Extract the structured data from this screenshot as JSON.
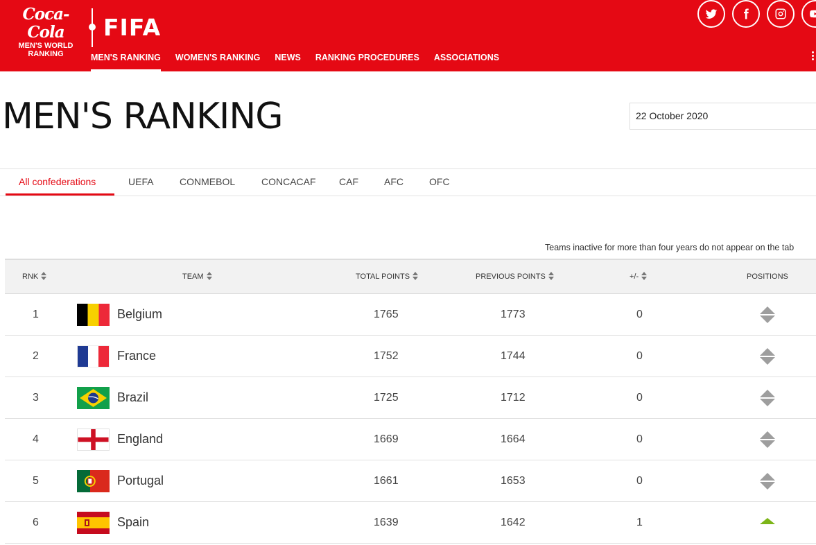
{
  "header": {
    "brand": {
      "logo_text": "Coca-Cola",
      "line1": "MEN'S WORLD",
      "line2": "RANKING",
      "fifa": "FIFA"
    },
    "nav": [
      {
        "label": "MEN'S RANKING",
        "active": true
      },
      {
        "label": "WOMEN'S RANKING",
        "active": false
      },
      {
        "label": "NEWS",
        "active": false
      },
      {
        "label": "RANKING PROCEDURES",
        "active": false
      },
      {
        "label": "ASSOCIATIONS",
        "active": false
      }
    ],
    "social": [
      "twitter-icon",
      "facebook-icon",
      "instagram-icon",
      "youtube-icon"
    ],
    "brand_color": "#e50914"
  },
  "page": {
    "title": "MEN'S RANKING",
    "date": "22 October 2020"
  },
  "tabs": [
    {
      "label": "All confederations",
      "active": true
    },
    {
      "label": "UEFA",
      "active": false
    },
    {
      "label": "CONMEBOL",
      "active": false
    },
    {
      "label": "CONCACAF",
      "active": false
    },
    {
      "label": "CAF",
      "active": false
    },
    {
      "label": "AFC",
      "active": false
    },
    {
      "label": "OFC",
      "active": false
    }
  ],
  "note": "Teams inactive for more than four years do not appear on the tab",
  "table": {
    "columns": {
      "rank": "RNK",
      "team": "TEAM",
      "total_points": "TOTAL POINTS",
      "previous_points": "PREVIOUS POINTS",
      "change": "+/-",
      "positions": "POSITIONS"
    },
    "rows": [
      {
        "rank": "1",
        "team": "Belgium",
        "flag": "belgium",
        "total": "1765",
        "previous": "1773",
        "change": "0",
        "movement": "same"
      },
      {
        "rank": "2",
        "team": "France",
        "flag": "france",
        "total": "1752",
        "previous": "1744",
        "change": "0",
        "movement": "same"
      },
      {
        "rank": "3",
        "team": "Brazil",
        "flag": "brazil",
        "total": "1725",
        "previous": "1712",
        "change": "0",
        "movement": "same"
      },
      {
        "rank": "4",
        "team": "England",
        "flag": "england",
        "total": "1669",
        "previous": "1664",
        "change": "0",
        "movement": "same"
      },
      {
        "rank": "5",
        "team": "Portugal",
        "flag": "portugal",
        "total": "1661",
        "previous": "1653",
        "change": "0",
        "movement": "same"
      },
      {
        "rank": "6",
        "team": "Spain",
        "flag": "spain",
        "total": "1639",
        "previous": "1642",
        "change": "1",
        "movement": "up"
      }
    ]
  },
  "colors": {
    "same": "#9e9e9e",
    "up": "#7cb518"
  }
}
